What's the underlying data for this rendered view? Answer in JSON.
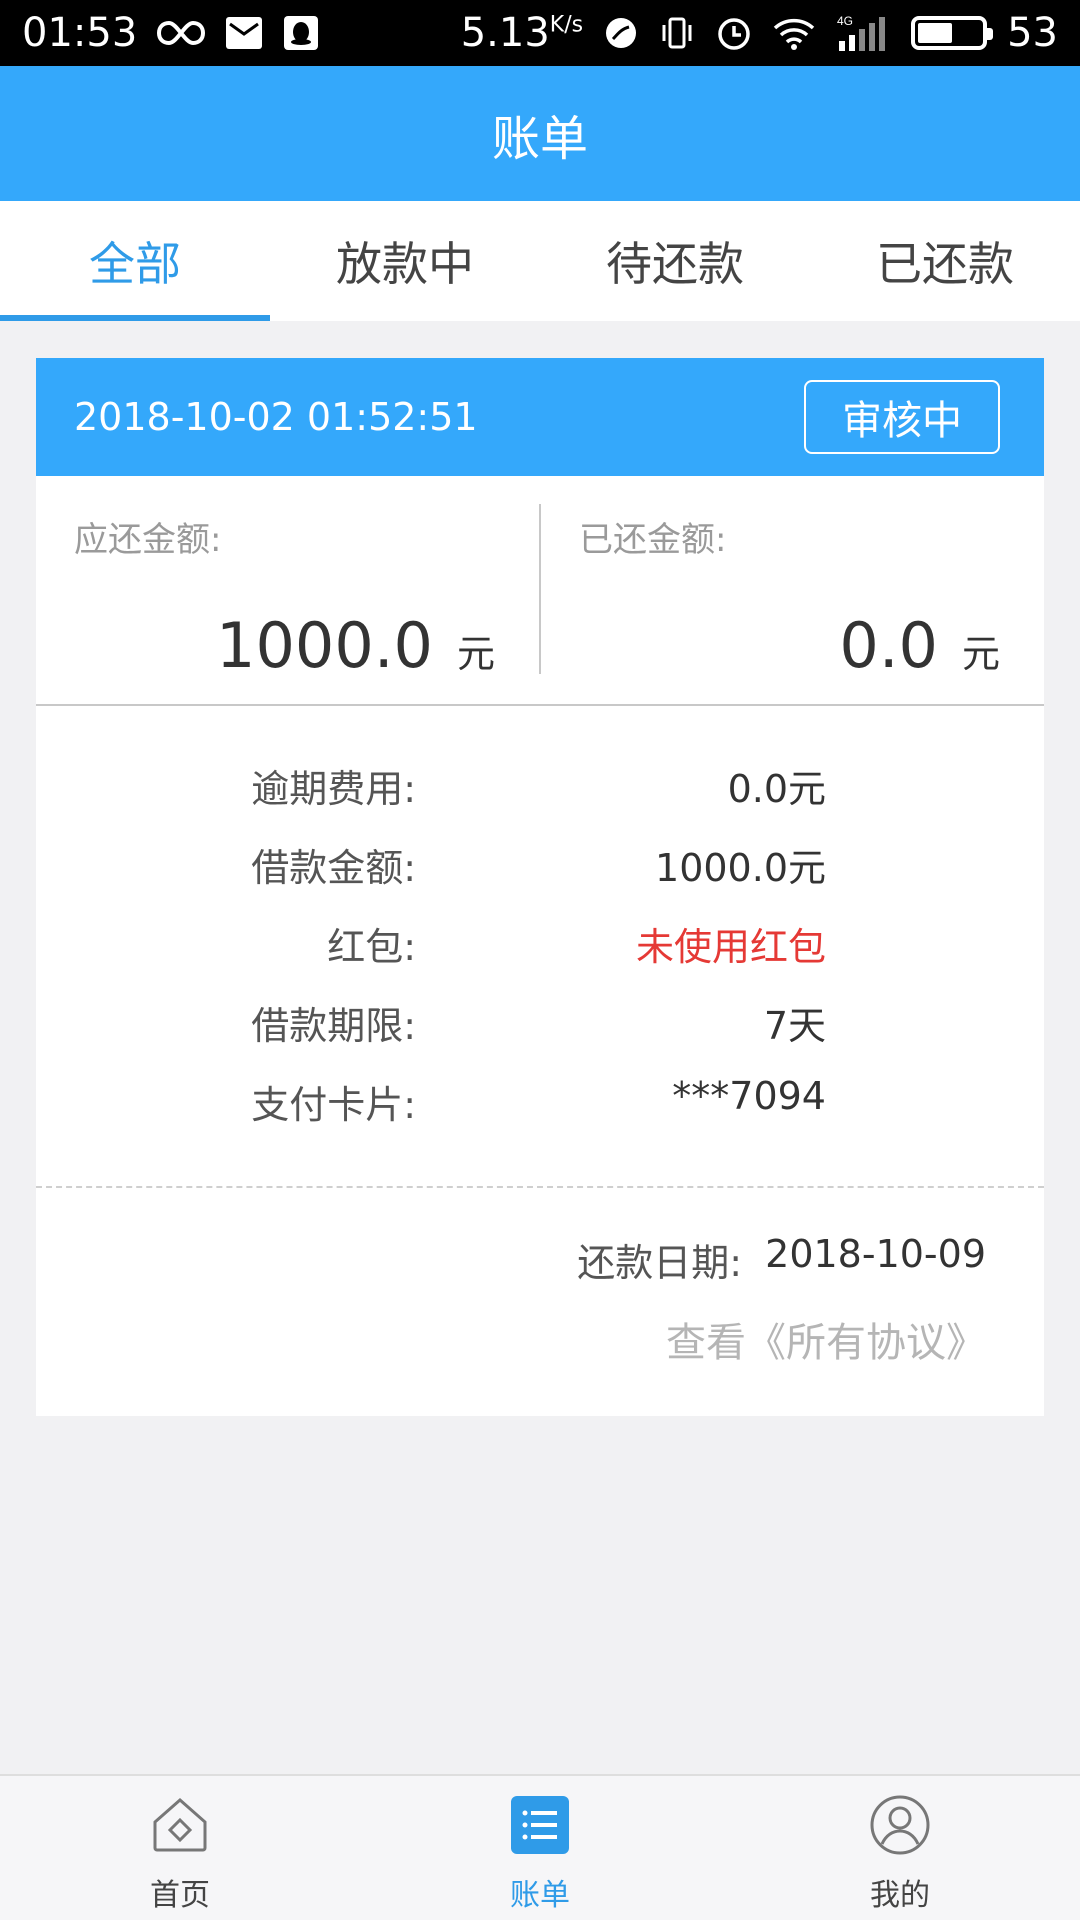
{
  "status_bar": {
    "time": "01:53",
    "net_speed": "5.13",
    "net_speed_unit": "K/s",
    "network_type": "4G",
    "battery": "53"
  },
  "header": {
    "title": "账单"
  },
  "tabs": [
    {
      "label": "全部",
      "active": true
    },
    {
      "label": "放款中",
      "active": false
    },
    {
      "label": "待还款",
      "active": false
    },
    {
      "label": "已还款",
      "active": false
    }
  ],
  "bill": {
    "datetime": "2018-10-02 01:52:51",
    "status": "审核中",
    "due_amount": {
      "label": "应还金额:",
      "value": "1000.0",
      "unit": "元"
    },
    "paid_amount": {
      "label": "已还金额:",
      "value": "0.0",
      "unit": "元"
    },
    "details": [
      {
        "label": "逾期费用:",
        "value": "0.0元",
        "highlight": false
      },
      {
        "label": "借款金额:",
        "value": "1000.0元",
        "highlight": false
      },
      {
        "label": "红包:",
        "value": "未使用红包",
        "highlight": true
      },
      {
        "label": "借款期限:",
        "value": "7天",
        "highlight": false
      },
      {
        "label": "支付卡片:",
        "value": "***7094",
        "highlight": false
      }
    ],
    "repay_date_label": "还款日期:",
    "repay_date": "2018-10-09",
    "agreement_link": "查看《所有协议》"
  },
  "bottom_nav": [
    {
      "label": "首页",
      "icon": "home-icon",
      "active": false
    },
    {
      "label": "账单",
      "icon": "bill-list-icon",
      "active": true
    },
    {
      "label": "我的",
      "icon": "user-icon",
      "active": false
    }
  ],
  "colors": {
    "primary": "#34a8fb",
    "tab_active": "#2f9be8",
    "highlight_red": "#e53935",
    "background": "#f1f1f3"
  }
}
